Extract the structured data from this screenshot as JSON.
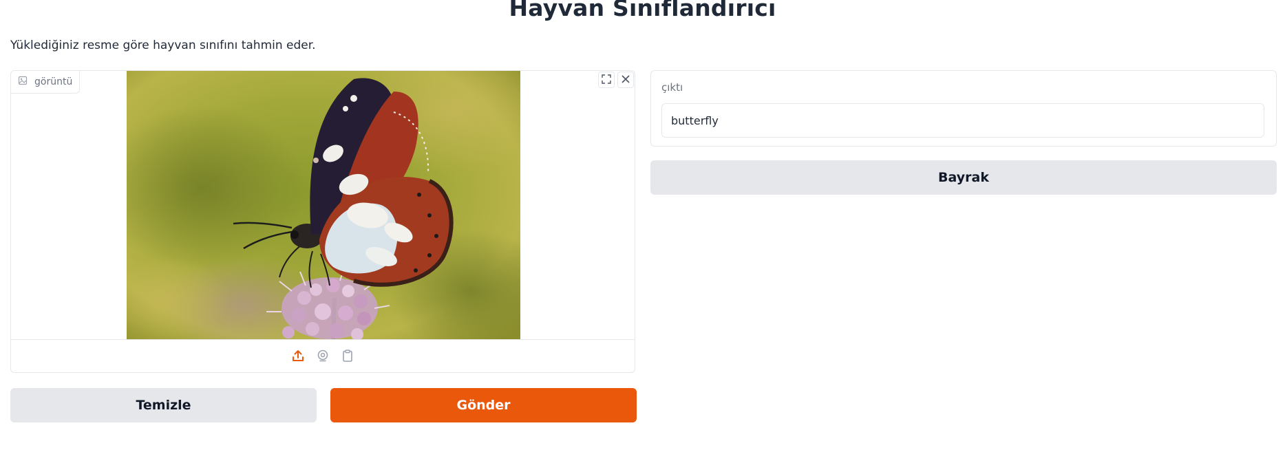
{
  "header": {
    "title": "Hayvan Sınıflandırıcı",
    "description": "Yüklediğiniz resme göre hayvan sınıfını tahmin eder."
  },
  "image_input": {
    "label": "görüntü",
    "label_icon": "image-icon",
    "corner_tools": [
      "fullscreen-icon",
      "close-icon"
    ],
    "sources": [
      "upload-icon",
      "webcam-icon",
      "clipboard-icon"
    ],
    "preview_subject": "butterfly-photo"
  },
  "buttons": {
    "clear_label": "Temizle",
    "submit_label": "Gönder",
    "flag_label": "Bayrak"
  },
  "output": {
    "label": "çıktı",
    "value": "butterfly"
  },
  "colors": {
    "accent": "#ea580c",
    "secondary_button": "#e5e7eb",
    "border": "#e5e7eb",
    "muted_text": "#6b7280"
  }
}
